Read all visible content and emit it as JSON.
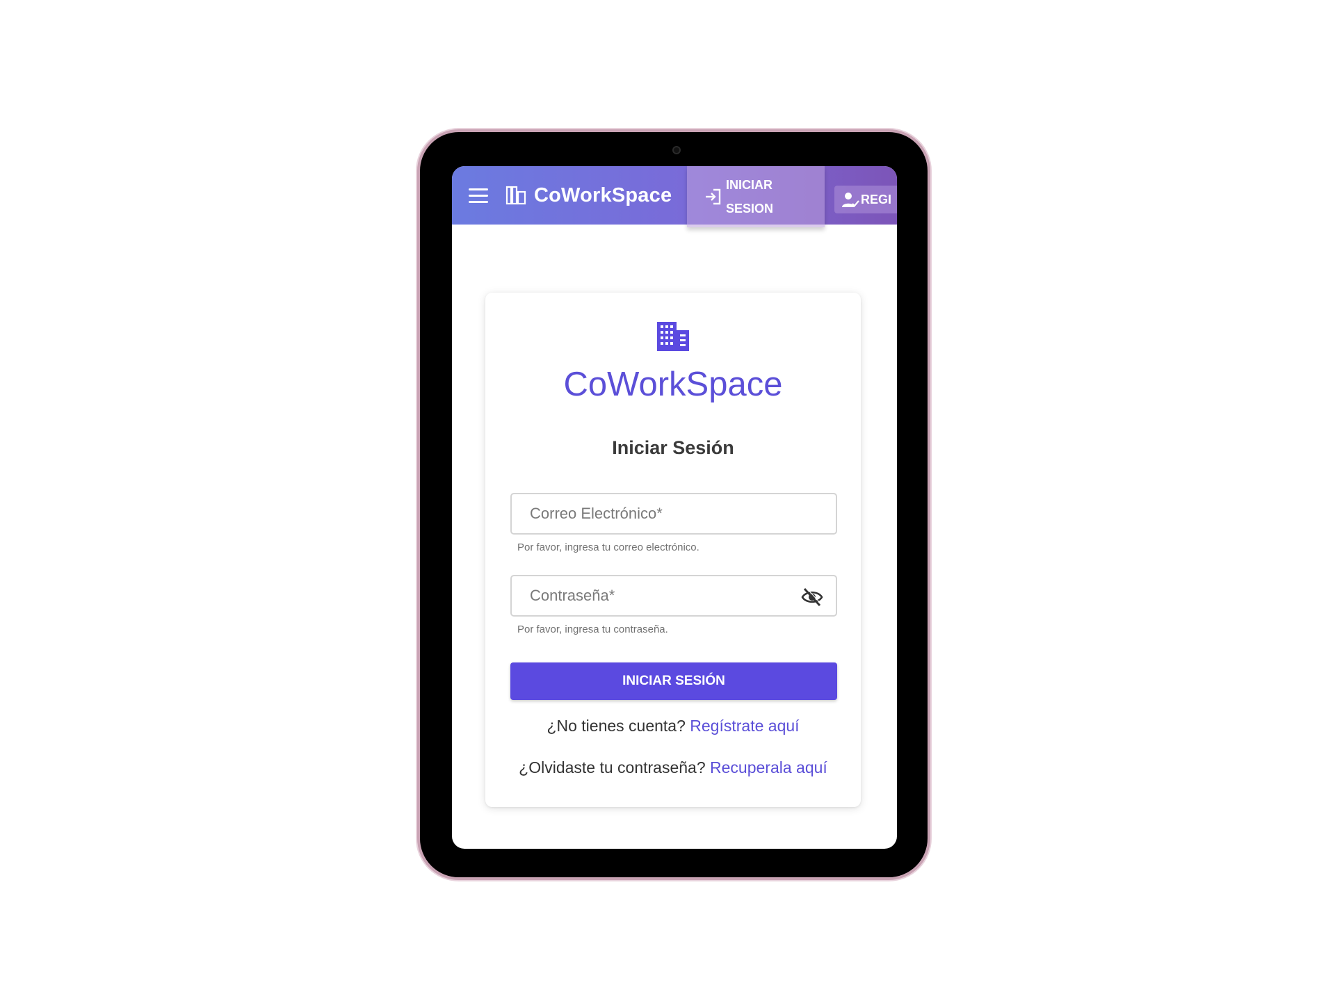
{
  "appbar": {
    "brand": "CoWorkSpace",
    "login_label": "INICIAR SESION",
    "register_label": "REGI"
  },
  "login_card": {
    "brand": "CoWorkSpace",
    "title": "Iniciar Sesión",
    "email": {
      "placeholder": "Correo Electrónico*",
      "helper": "Por favor, ingresa tu correo electrónico."
    },
    "password": {
      "placeholder": "Contraseña*",
      "helper": "Por favor, ingresa tu contraseña."
    },
    "submit_label": "INICIAR SESIÓN",
    "register_prompt": "¿No tienes cuenta?",
    "register_link": "Regístrate aquí",
    "recover_prompt": "¿Olvidaste tu contraseña?",
    "recover_link": "Recuperala aquí"
  },
  "icons": {
    "menu": "menu-icon",
    "brand": "building-icon",
    "login": "login-icon",
    "register": "person-check-icon",
    "visibility": "eye-off-icon"
  },
  "colors": {
    "primary": "#5b4ae0",
    "brand_text": "#5b4fd8",
    "appbar_start": "#6b7be0",
    "appbar_end": "#7c55b8"
  }
}
